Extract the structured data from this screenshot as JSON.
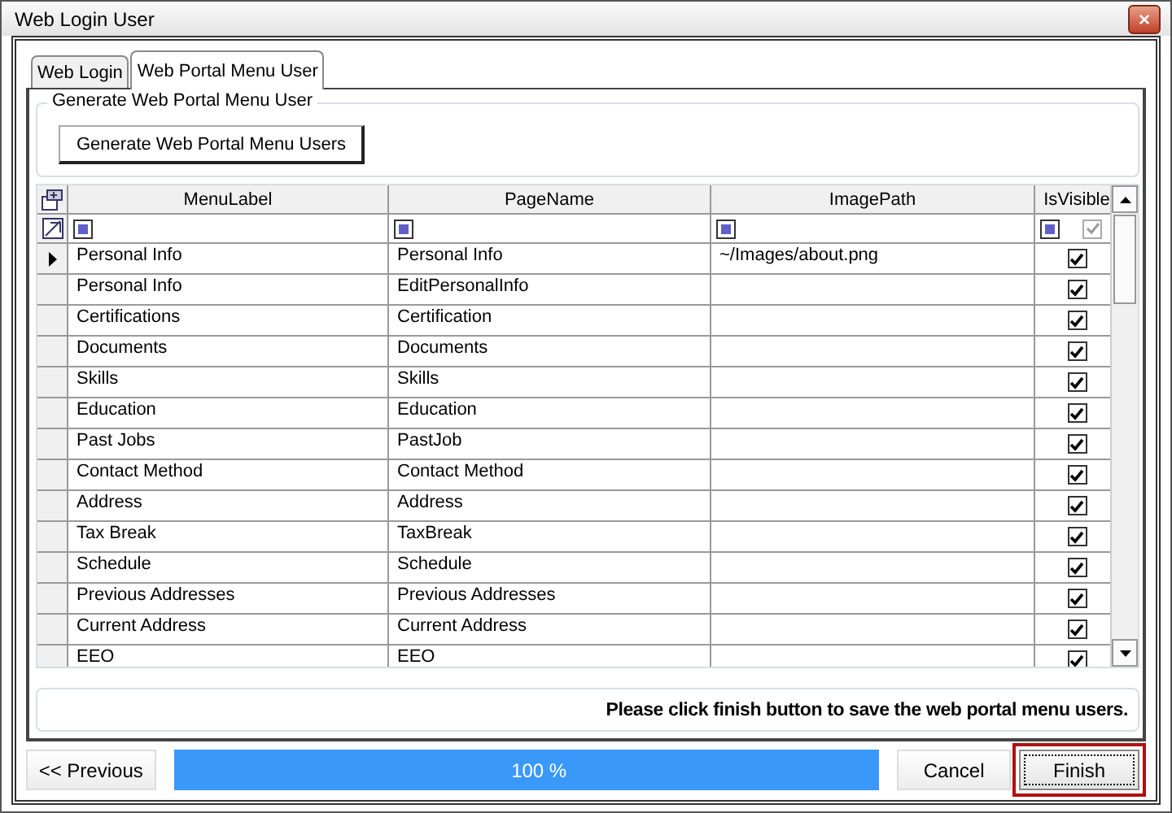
{
  "window": {
    "title": "Web Login User",
    "close": "×"
  },
  "tabs": [
    {
      "label": "Web Login",
      "selected": false
    },
    {
      "label": "Web Portal Menu User",
      "selected": true
    }
  ],
  "group": {
    "title": "Generate Web Portal Menu User",
    "button": "Generate Web Portal Menu Users"
  },
  "table": {
    "columns": [
      "MenuLabel",
      "PageName",
      "ImagePath",
      "IsVisible"
    ],
    "filter_row": {
      "is_visible": {
        "checked": true
      }
    },
    "rows": [
      {
        "menu_label": "Personal Info",
        "page_name": "Personal Info",
        "image_path": "~/Images/about.png",
        "is_visible": true,
        "selected": true
      },
      {
        "menu_label": "Personal Info",
        "page_name": "EditPersonalInfo",
        "is_visible": true,
        "selected": false
      },
      {
        "menu_label": "Certifications",
        "page_name": "Certification",
        "is_visible": true,
        "selected": false
      },
      {
        "menu_label": "Documents",
        "page_name": "Documents",
        "is_visible": true,
        "selected": false
      },
      {
        "menu_label": "Skills",
        "page_name": "Skills",
        "is_visible": true,
        "selected": false
      },
      {
        "menu_label": "Education",
        "page_name": "Education",
        "is_visible": true,
        "selected": false
      },
      {
        "menu_label": "Past Jobs",
        "page_name": "PastJob",
        "is_visible": true,
        "selected": false
      },
      {
        "menu_label": "Contact Method",
        "page_name": "Contact Method",
        "is_visible": true,
        "selected": false
      },
      {
        "menu_label": "Address",
        "page_name": "Address",
        "is_visible": true,
        "selected": false
      },
      {
        "menu_label": "Tax Break",
        "page_name": "TaxBreak",
        "is_visible": true,
        "selected": false
      },
      {
        "menu_label": "Schedule",
        "page_name": "Schedule",
        "is_visible": true,
        "selected": false
      },
      {
        "menu_label": "Previous Addresses",
        "page_name": "Previous Addresses",
        "is_visible": true,
        "selected": false
      },
      {
        "menu_label": "Current Address",
        "page_name": "Current Address",
        "is_visible": true,
        "selected": false
      },
      {
        "menu_label": "EEO",
        "page_name": "EEO",
        "is_visible": true,
        "selected": false
      }
    ]
  },
  "message": "Please click finish button to save the web portal menu users.",
  "footer": {
    "previous": "<< Previous",
    "progress": {
      "level": 1,
      "label": "100 %"
    },
    "cancel": "Cancel",
    "finish": {
      "label": "Finish",
      "highlighted": true
    }
  }
}
